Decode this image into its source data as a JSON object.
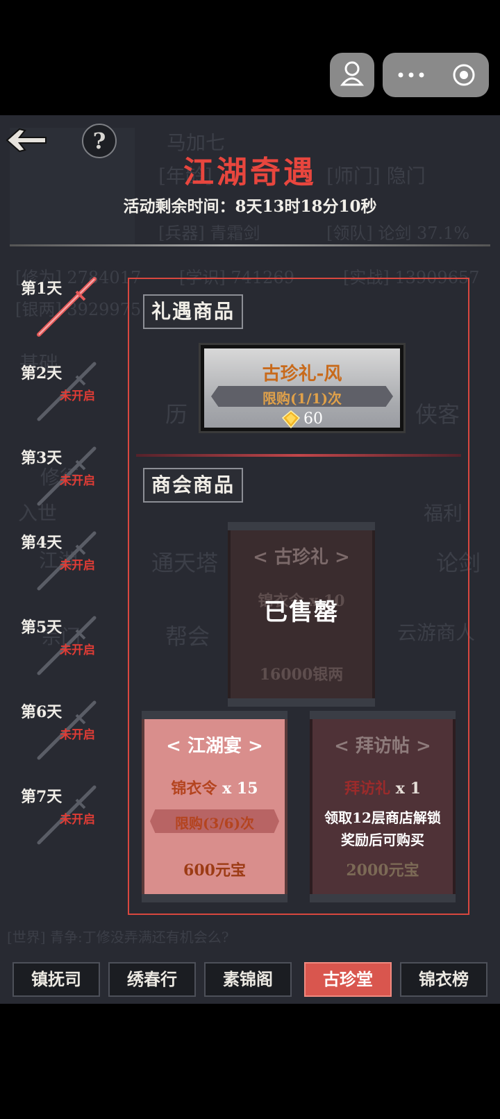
{
  "title": "江湖奇遇",
  "timer": "活动剩余时间：8天13时18分10秒",
  "days": [
    {
      "label": "第1天",
      "status": ""
    },
    {
      "label": "第2天",
      "status": "未开启"
    },
    {
      "label": "第3天",
      "status": "未开启"
    },
    {
      "label": "第4天",
      "status": "未开启"
    },
    {
      "label": "第5天",
      "status": "未开启"
    },
    {
      "label": "第6天",
      "status": "未开启"
    },
    {
      "label": "第7天",
      "status": "未开启"
    }
  ],
  "section1": {
    "title": "礼遇商品",
    "item": {
      "name": "古珍礼-风",
      "limit": "限购(1/1)次",
      "price": "60",
      "price_icon": "diamond-icon"
    }
  },
  "section2": {
    "title": "商会商品",
    "soldout_card": {
      "title": "< 古珍礼 >",
      "sub": "锦衣令 x 10",
      "overlay": "已售罄",
      "price": "16000银两"
    },
    "feast_card": {
      "title": "< 江湖宴 >",
      "item": "锦衣令",
      "qty": "x 15",
      "limit": "限购(3/6)次",
      "price": "600元宝"
    },
    "visit_card": {
      "title": "< 拜访帖 >",
      "item": "拜访礼",
      "qty": "x 1",
      "note1": "领取12层商店解锁",
      "note2": "奖励后可购买",
      "price": "2000元宝"
    }
  },
  "tabs": [
    "镇抚司",
    "绣春行",
    "素锦阁",
    "古珍堂",
    "锦衣榜"
  ],
  "active_tab": "古珍堂",
  "background_text": [
    "马加七",
    "[年龄]",
    "[师门] 隐门",
    "[兵器] 青霜剑",
    "[领队] 论剑 37.1%",
    "[修为] 2784017",
    "[学识] 741269",
    "[实战] 13909657",
    "[银两] 3929975",
    "基础",
    "历",
    "侠客",
    "修行",
    "入世",
    "福利",
    "江湖",
    "通天塔",
    "论剑",
    "宗门",
    "帮会",
    "云游商人",
    "[世界] 青争:丁修没弄满还有机会么?"
  ],
  "colors": {
    "accent_red": "#e8463e",
    "panel_border": "#d9473f",
    "bg": "#282a32",
    "active_tab": "#d9564e"
  }
}
